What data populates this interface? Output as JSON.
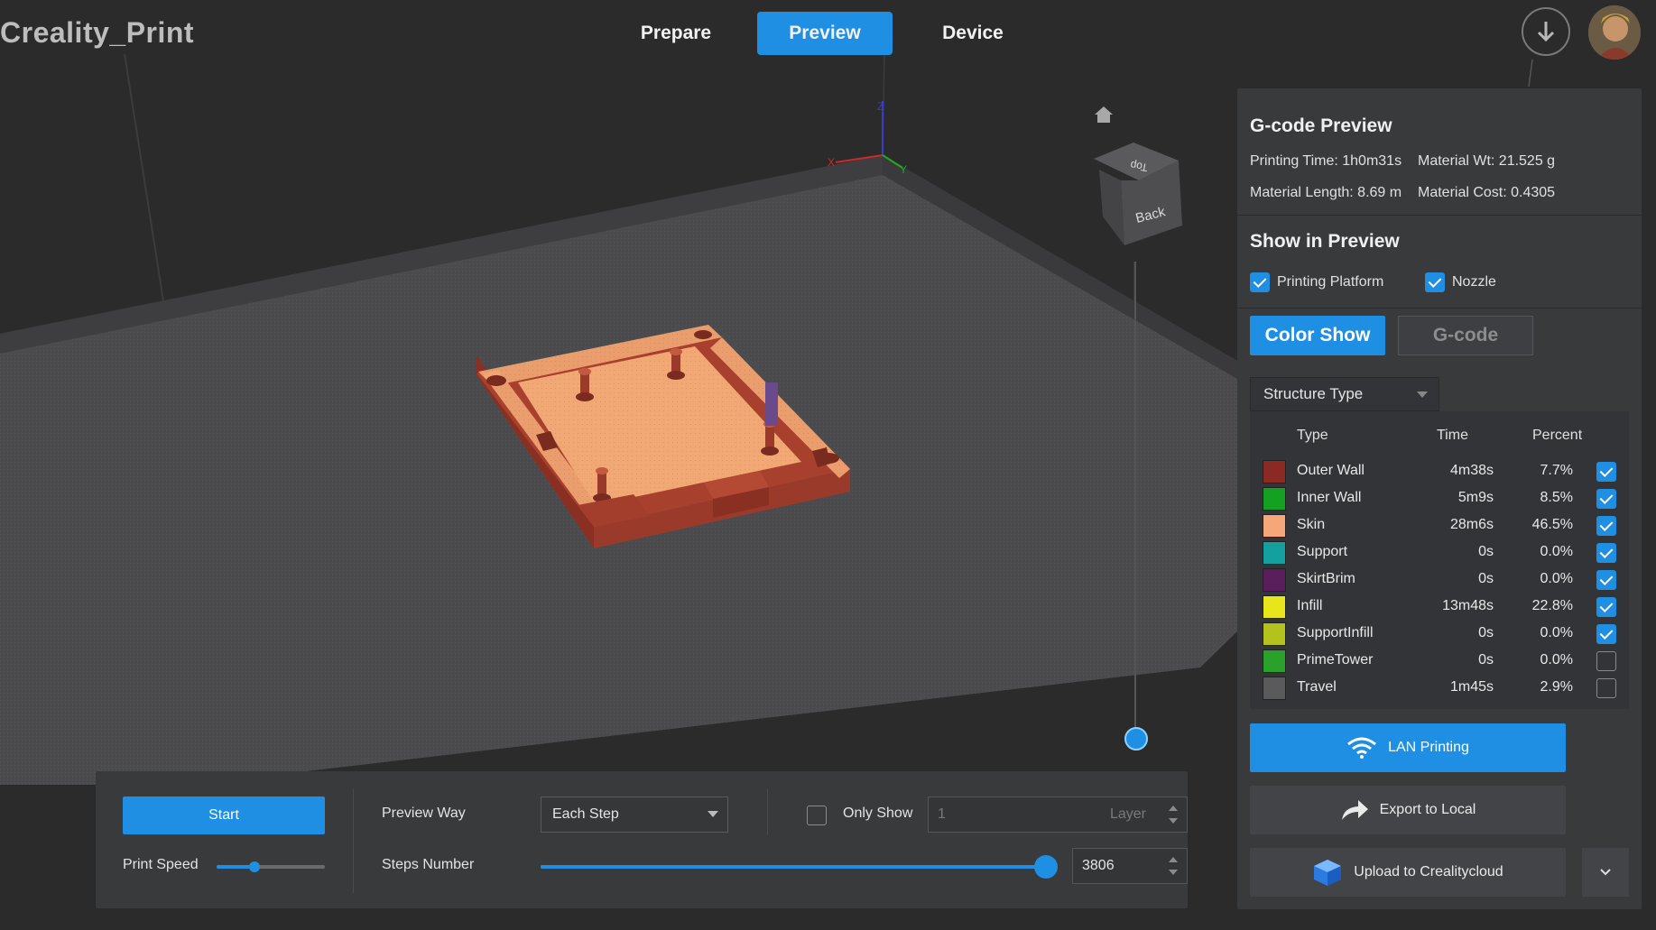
{
  "app": {
    "title": "Creality_Print"
  },
  "nav": {
    "tabs": [
      {
        "label": "Prepare"
      },
      {
        "label": "Preview"
      },
      {
        "label": "Device"
      }
    ],
    "active": "Preview"
  },
  "viewport": {
    "cube": {
      "top_label": "Top",
      "back_label": "Back"
    },
    "axes": {
      "x": "X",
      "y": "Y",
      "z": "Z"
    }
  },
  "gcode_preview": {
    "title": "G-code Preview",
    "printing_time": "Printing Time: 1h0m31s",
    "material_wt": "Material Wt: 21.525 g",
    "material_length": "Material Length: 8.69 m",
    "material_cost": "Material Cost: 0.4305"
  },
  "show_in_preview": {
    "title": "Show in Preview",
    "printing_platform": {
      "label": "Printing Platform",
      "checked": true
    },
    "nozzle": {
      "label": "Nozzle",
      "checked": true
    }
  },
  "mode_buttons": {
    "color_show": "Color Show",
    "gcode": "G-code",
    "active": "Color Show"
  },
  "structure": {
    "dropdown": "Structure Type",
    "headers": {
      "type": "Type",
      "time": "Time",
      "percent": "Percent"
    },
    "rows": [
      {
        "name": "Outer Wall",
        "time": "4m38s",
        "percent": "7.7%",
        "color": "#8a2a22",
        "checked": true
      },
      {
        "name": "Inner Wall",
        "time": "5m9s",
        "percent": "8.5%",
        "color": "#14a020",
        "checked": true
      },
      {
        "name": "Skin",
        "time": "28m6s",
        "percent": "46.5%",
        "color": "#f5a77a",
        "checked": true
      },
      {
        "name": "Support",
        "time": "0s",
        "percent": "0.0%",
        "color": "#15a0a0",
        "checked": true
      },
      {
        "name": "SkirtBrim",
        "time": "0s",
        "percent": "0.0%",
        "color": "#5a1e5c",
        "checked": true
      },
      {
        "name": "Infill",
        "time": "13m48s",
        "percent": "22.8%",
        "color": "#e6e61a",
        "checked": true
      },
      {
        "name": "SupportInfill",
        "time": "0s",
        "percent": "0.0%",
        "color": "#b4c21e",
        "checked": true
      },
      {
        "name": "PrimeTower",
        "time": "0s",
        "percent": "0.0%",
        "color": "#2aa12a",
        "checked": false
      },
      {
        "name": "Travel",
        "time": "1m45s",
        "percent": "2.9%",
        "color": "#5a5a5c",
        "checked": false
      }
    ]
  },
  "actions": {
    "lan_printing": "LAN Printing",
    "export_local": "Export to Local",
    "upload_cloud": "Upload to Crealitycloud"
  },
  "bottom_panel": {
    "start": "Start",
    "print_speed": {
      "label": "Print Speed",
      "value_fraction": 0.35
    },
    "preview_way": {
      "label": "Preview Way",
      "value": "Each Step"
    },
    "only_show": {
      "label": "Only Show",
      "checked": false,
      "layer_value": "1",
      "layer_unit": "Layer"
    },
    "steps_number": {
      "label": "Steps Number",
      "value": "3806",
      "fraction": 1.0
    }
  },
  "colors": {
    "accent": "#1e8fe3",
    "panel": "#393a3c",
    "background": "#2b2b2c"
  },
  "icons": [
    "download-icon",
    "home-icon",
    "wifi-icon",
    "share-icon",
    "cloud-cube-icon",
    "chevron-down-icon"
  ]
}
